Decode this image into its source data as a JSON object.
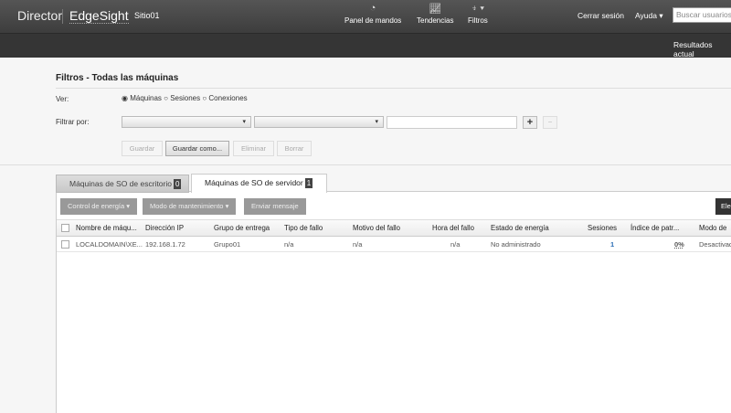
{
  "header": {
    "brand": "Director",
    "product": "EdgeSight",
    "site": "Sitio01",
    "nav": [
      {
        "label": "Panel de mandos",
        "icon": "gauge-icon"
      },
      {
        "label": "Tendencias",
        "icon": "chart-icon"
      },
      {
        "label": "Filtros",
        "icon": "filter-icon"
      }
    ],
    "logout": "Cerrar sesión",
    "help": "Ayuda",
    "search_placeholder": "Buscar usuarios"
  },
  "subbar": {
    "results": "Resultados actual"
  },
  "filters": {
    "title": "Filtros - Todas las máquinas",
    "view_label": "Ver:",
    "view_options": [
      "Máquinas",
      "Sesiones",
      "Conexiones"
    ],
    "view_selected": "Máquinas",
    "filter_label": "Filtrar por:",
    "filter_value": "",
    "buttons": {
      "save": "Guardar",
      "save_as": "Guardar como...",
      "delete": "Eliminar",
      "clear": "Borrar"
    }
  },
  "tabs": [
    {
      "label": "Máquinas de SO de escritorio",
      "count": "0"
    },
    {
      "label": "Máquinas de SO de servidor",
      "count": "1"
    }
  ],
  "toolbar": {
    "power": "Control de energía",
    "maintenance": "Modo de mantenimiento",
    "message": "Enviar mensaje",
    "right": "Ele"
  },
  "table": {
    "columns": [
      "Nombre de máqu...",
      "Dirección IP",
      "Grupo de entrega",
      "Tipo de fallo",
      "Motivo del fallo",
      "Hora del fallo",
      "Estado de energía",
      "Sesiones",
      "Índice de patr...",
      "Modo de"
    ],
    "rows": [
      [
        "LOCALDOMAIN\\XE...",
        "192.168.1.72",
        "Grupo01",
        "n/a",
        "n/a",
        "n/a",
        "No administrado",
        "1",
        "0%",
        "Desactivad"
      ]
    ]
  }
}
